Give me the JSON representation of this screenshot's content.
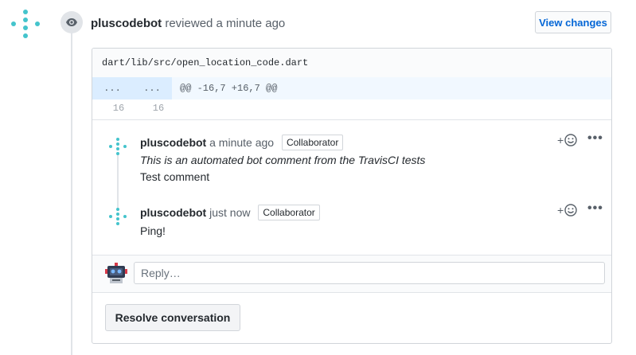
{
  "review_event": {
    "author": "pluscodebot",
    "action_text": "reviewed a minute ago",
    "view_changes_label": "View changes"
  },
  "file": {
    "path": "dart/lib/src/open_location_code.dart",
    "hunk": {
      "left_num": "...",
      "right_num": "...",
      "header": "@@ -16,7 +16,7 @@"
    },
    "line": {
      "left_num": "16",
      "right_num": "16"
    }
  },
  "comments": [
    {
      "author": "pluscodebot",
      "time": "a minute ago",
      "badge": "Collaborator",
      "body_italic": "This is an automated bot comment from the TravisCI tests",
      "body": "Test comment",
      "reaction_label": "+",
      "more_label": "•••"
    },
    {
      "author": "pluscodebot",
      "time": "just now",
      "badge": "Collaborator",
      "body": "Ping!",
      "reaction_label": "+",
      "more_label": "•••"
    }
  ],
  "reply": {
    "placeholder": "Reply…"
  },
  "resolve_label": "Resolve conversation",
  "icons": {
    "avatar": "pluscode-dots-icon",
    "event": "eye-icon",
    "reaction": "smiley-icon",
    "reply_avatar": "robot-avatar-icon"
  },
  "colors": {
    "accent": "#0366d6",
    "dots": "#44c4cc",
    "hunk_bg": "#f1f8ff",
    "hunk_num_bg": "#dbedff"
  }
}
